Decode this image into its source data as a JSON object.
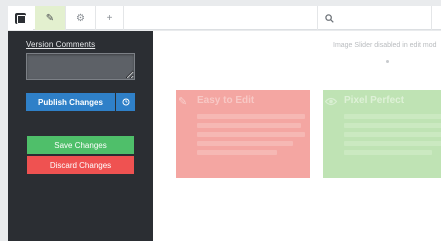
{
  "toolbar": {
    "tabs": [
      {
        "icon": "logo-icon"
      },
      {
        "icon": "pencil-icon",
        "active": true
      },
      {
        "icon": "gear-icon"
      },
      {
        "icon": "plus-icon"
      }
    ],
    "search_icon": "search-icon",
    "active_tab_color": "#e3f0cf"
  },
  "sidebar": {
    "version_comments_label": "Version Comments",
    "version_comments_value": "",
    "publish_label": "Publish Changes",
    "publish_options_icon": "clock-icon",
    "save_label": "Save Changes",
    "discard_label": "Discard Changes",
    "colors": {
      "background": "#2b2e33",
      "publish": "#2f80c8",
      "save": "#4fbf6a",
      "discard": "#ef5251"
    }
  },
  "main": {
    "notice": "Image Slider disabled in edit mod",
    "cards": [
      {
        "title": "Easy to Edit",
        "icon": "pencil-icon",
        "color": "#f4a6a2"
      },
      {
        "title": "Pixel Perfect",
        "icon": "eye-icon",
        "color": "#bfe3b4"
      }
    ]
  }
}
